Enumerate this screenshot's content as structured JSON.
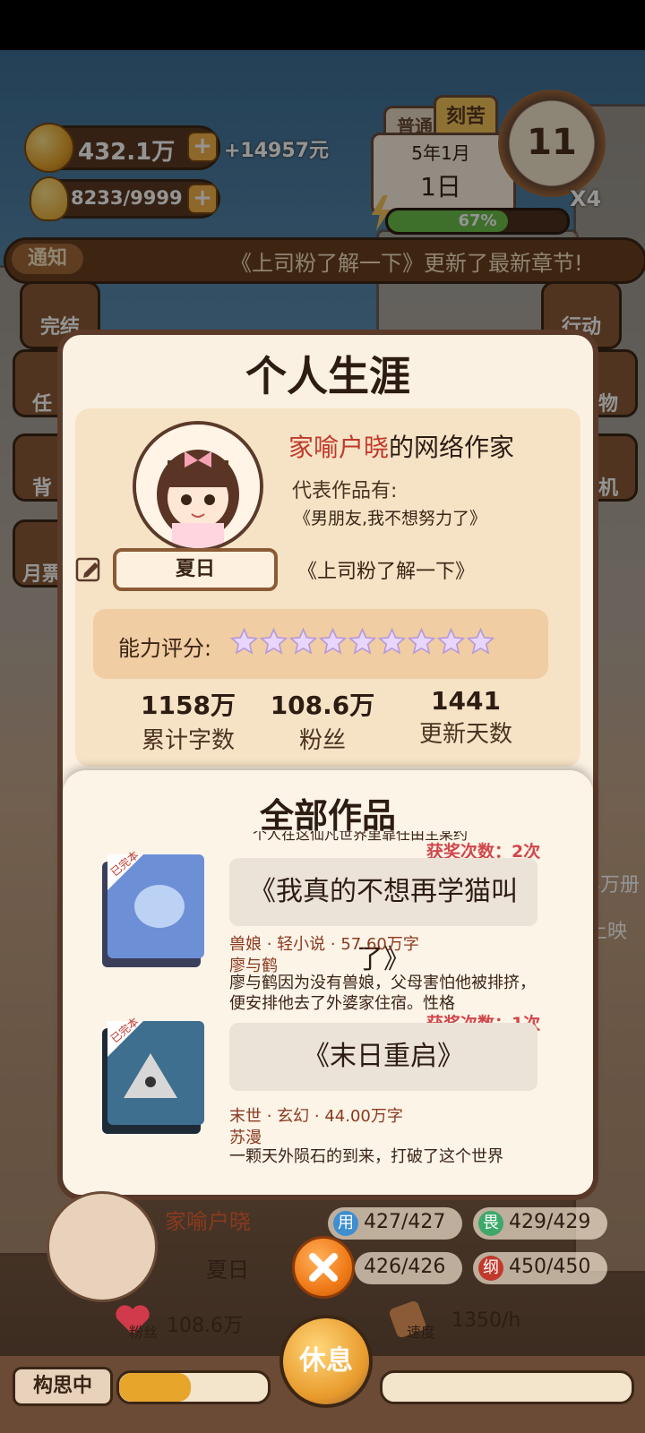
{
  "hud": {
    "coins": "432.1万",
    "coin_delta": "+14957元",
    "energy": "8233/9999",
    "mode_normal": "普通",
    "mode_hard": "刻苦",
    "date_line1": "5年1月",
    "date_line2": "1日",
    "clock_value": "11",
    "speed_multiplier": "X4",
    "progress_percent": "67%",
    "progress_fraction": 0.67
  },
  "notice": {
    "tag": "通知",
    "text": "《上司粉了解一下》更新了最新章节!"
  },
  "side_buttons_left": [
    "完结",
    "任",
    "背",
    "月票"
  ],
  "side_buttons_right": [
    "行动",
    "物",
    "机"
  ],
  "right_peek": [
    "4万册",
    "上映"
  ],
  "modal": {
    "title": "个人生涯",
    "author_prefix": "家喻户晓",
    "author_suffix": "的网络作家",
    "rep_label": "代表作品有:",
    "rep_works": [
      "《男朋友,我不想努力了》",
      "《上司粉了解一下》"
    ],
    "player_name": "夏日",
    "rating_label": "能力评分:",
    "rating_stars": 9,
    "stats": [
      {
        "value": "1158万",
        "label": "累计字数"
      },
      {
        "value": "108.6万",
        "label": "粉丝"
      },
      {
        "value": "1441",
        "label": "更新天数"
      }
    ],
    "works_title": "全部作品",
    "works_cutoff_text": "个人在这仙凡世界里靠任由主某约",
    "works": [
      {
        "badge": "已完本",
        "title": "《我真的不想再学猫叫了》",
        "award": "获奖次数：2次",
        "meta": "兽娘 · 轻小说 · 57.60万字",
        "protagonist": "廖与鹤",
        "desc": "廖与鹤因为没有兽娘，父母害怕他被排挤，便安排他去了外婆家住宿。性格"
      },
      {
        "badge": "已完本",
        "title": "《末日重启》",
        "award": "获奖次数：1次",
        "meta": "末世 · 玄幻 · 44.00万字",
        "protagonist": "苏漫",
        "desc": "一颗天外陨石的到来，打破了这个世界"
      }
    ]
  },
  "bottom": {
    "author_title": "家喻户晓",
    "name": "夏日",
    "stat1": "427/427",
    "stat2": "429/429",
    "stat3": "426/426",
    "stat4_icon_label": "纲",
    "stat4": "450/450",
    "stat1_icon_label": "用",
    "stat2_icon_label": "畏",
    "fans_label": "粉丝",
    "fans_value": "108.6万",
    "speed_label": "速度",
    "speed_value": "1350/h",
    "status": "构思中",
    "rest_button": "休息"
  }
}
